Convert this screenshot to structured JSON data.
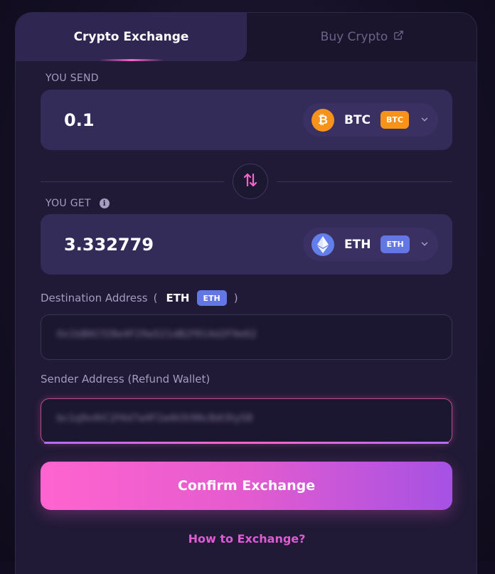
{
  "tabs": {
    "active_label": "Crypto Exchange",
    "inactive_label": "Buy Crypto",
    "inactive_icon": "external-link-icon"
  },
  "send": {
    "label": "YOU SEND",
    "amount": "0.1",
    "coin": "BTC",
    "badge": "BTC",
    "icon": "bitcoin-icon",
    "icon_glyph": "₿",
    "icon_color": "#f7931a",
    "badge_color": "#f7931a"
  },
  "receive": {
    "label": "YOU GET",
    "info_icon": "info-icon",
    "amount": "3.332779",
    "coin": "ETH",
    "badge": "ETH",
    "icon": "ethereum-icon",
    "icon_color": "#627eea",
    "badge_color": "#6277e4"
  },
  "destination": {
    "label": "Destination Address",
    "open_paren": "(",
    "currency": "ETH",
    "badge": "ETH",
    "close_paren": ")",
    "value_blurred": "0x1bB6Cf28e4F29a521dB2f914d2F9e62"
  },
  "sender": {
    "label": "Sender Address (Refund Wallet)",
    "value_blurred": "bc1q9x4tC2f4d7a4F2a4k5t96c8dl3ty58"
  },
  "confirm_label": "Confirm Exchange",
  "how_link": "How to Exchange?",
  "colors": {
    "accent_pink": "#ff64cf",
    "accent_purple": "#a552e4",
    "card_bg": "#201a36",
    "field_bg": "#332b58"
  }
}
